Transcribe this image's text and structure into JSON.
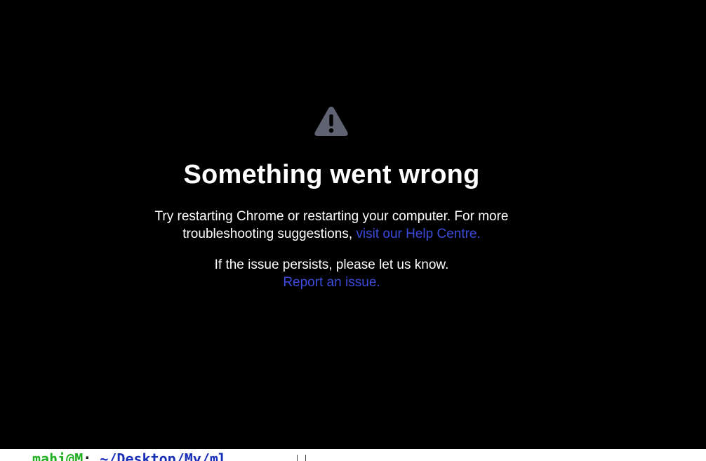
{
  "error": {
    "icon": "warning-triangle-icon",
    "icon_color": "#5f6270",
    "title": "Something went wrong",
    "message_text": "Try restarting Chrome or restarting your computer. For more troubleshooting suggestions,",
    "help_link": "visit our Help Centre.",
    "persist_text": "If the issue persists, please let us know.",
    "report_link": "Report an issue.",
    "link_color": "#3c4bd9"
  },
  "terminal": {
    "user": "mahi@M",
    "separator": ":",
    "path": "~/Desktop/My/ml"
  }
}
